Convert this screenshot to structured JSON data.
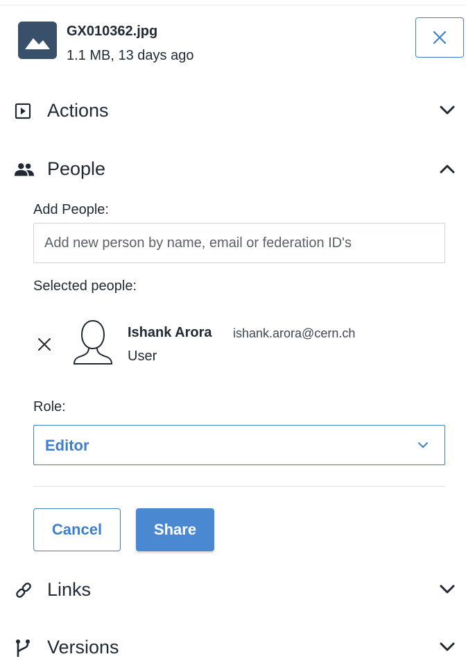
{
  "file": {
    "name": "GX010362.jpg",
    "meta": "1.1 MB, 13 days ago",
    "thumbnail_icon": "image-icon"
  },
  "close_icon": "close-icon",
  "sections": {
    "actions": {
      "label": "Actions",
      "icon": "play-square-icon",
      "expanded": false
    },
    "people": {
      "label": "People",
      "icon": "people-icon",
      "expanded": true
    },
    "links": {
      "label": "Links",
      "icon": "link-icon",
      "expanded": false
    },
    "versions": {
      "label": "Versions",
      "icon": "branch-icon",
      "expanded": false
    }
  },
  "people_panel": {
    "add_label": "Add People:",
    "add_placeholder": "Add new person by name, email or federation ID's",
    "selected_label": "Selected people:",
    "selected": [
      {
        "name": "Ishank Arora",
        "email": "ishank.arora@cern.ch",
        "type": "User"
      }
    ],
    "role_label": "Role:",
    "role_value": "Editor",
    "cancel_label": "Cancel",
    "share_label": "Share"
  },
  "colors": {
    "accent": "#3d80c9",
    "primary_button": "#4a89d2",
    "thumbnail_bg": "#39506a",
    "text": "#1f2833"
  }
}
